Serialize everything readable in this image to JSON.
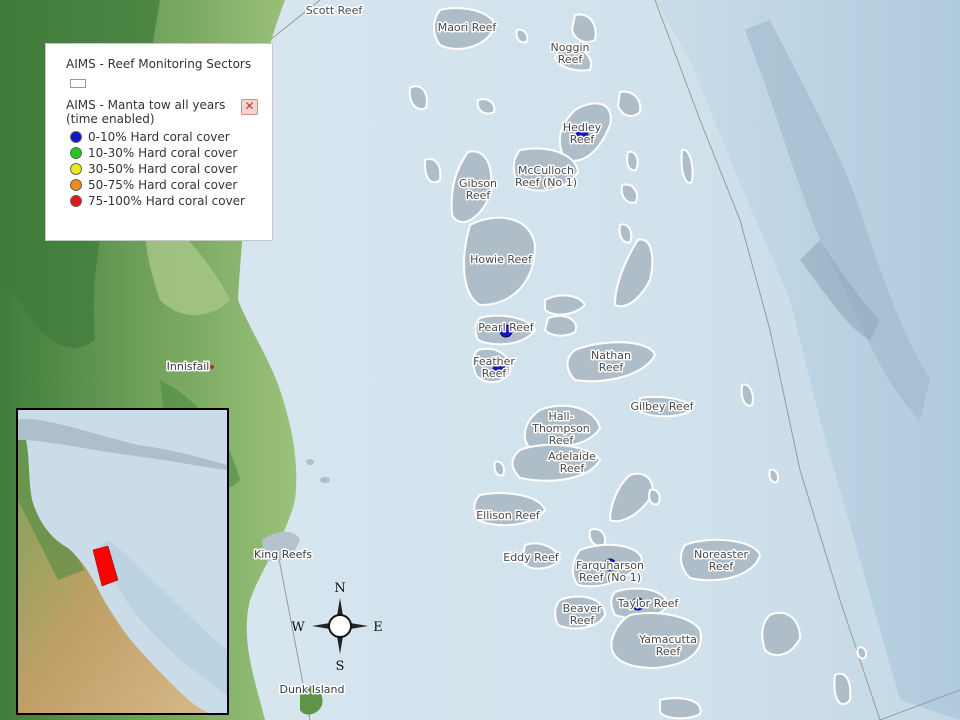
{
  "legend": {
    "sectors_title": "AIMS - Reef Monitoring Sectors",
    "manta_title": "AIMS - Manta tow all years (time enabled)",
    "remove_symbol": "✕",
    "items": [
      {
        "label": "0-10% Hard coral cover",
        "color": "#1515c8"
      },
      {
        "label": "10-30% Hard coral cover",
        "color": "#22c922"
      },
      {
        "label": "30-50% Hard coral cover",
        "color": "#eaea1a"
      },
      {
        "label": "50-75% Hard coral cover",
        "color": "#f08a1c"
      },
      {
        "label": "75-100% Hard coral cover",
        "color": "#e21818"
      }
    ]
  },
  "labels": {
    "scott_reef": "Scott Reef",
    "maori_reef": "Maori Reef",
    "noggin_reef": [
      "Noggin",
      "Reef"
    ],
    "hedley_reef": [
      "Hedley",
      "Reef"
    ],
    "mcculloch_reef": [
      "McCulloch",
      "Reef (No 1)"
    ],
    "gibson_reef": [
      "Gibson",
      "Reef"
    ],
    "howie_reef": "Howie Reef",
    "pearl_reef": "Pearl Reef",
    "feather_reef": [
      "Feather",
      "Reef"
    ],
    "nathan_reef": [
      "Nathan",
      "Reef"
    ],
    "gilbey_reef": "Gilbey Reef",
    "hall_thompson_reef": [
      "Hall-",
      "Thompson",
      "Reef"
    ],
    "adelaide_reef": [
      "Adelaide",
      "Reef"
    ],
    "ellison_reef": "Ellison Reef",
    "eddy_reef": "Eddy Reef",
    "farquharson_reef": [
      "Farquharson",
      "Reef (No 1)"
    ],
    "noreaster_reef": [
      "Noreaster",
      "Reef"
    ],
    "beaver_reef": [
      "Beaver",
      "Reef"
    ],
    "taylor_reef": "Taylor Reef",
    "yamacutta_reef": [
      "Yamacutta",
      "Reef"
    ],
    "innisfail": "Innisfail",
    "king_reefs": "King Reefs",
    "dunk_island": "Dunk Island"
  },
  "compass": {
    "n": "N",
    "s": "S",
    "e": "E",
    "w": "W"
  },
  "survey_points": [
    {
      "reef": "Hedley Reef",
      "cover_class": "0-10% Hard coral cover"
    },
    {
      "reef": "Pearl Reef",
      "cover_class": "0-10% Hard coral cover"
    },
    {
      "reef": "Feather Reef",
      "cover_class": "0-10% Hard coral cover"
    },
    {
      "reef": "Farquharson Reef (No 1)",
      "cover_class": "0-10% Hard coral cover"
    },
    {
      "reef": "Taylor Reef",
      "cover_class": "0-10% Hard coral cover"
    }
  ],
  "colors": {
    "sea": "#d4e4ee",
    "land_green": "#7fae63",
    "land_dark": "#4f8a45",
    "reef": "#aebdc8",
    "highlight_sector": "#ff0000",
    "survey_point": "#1515c8"
  }
}
